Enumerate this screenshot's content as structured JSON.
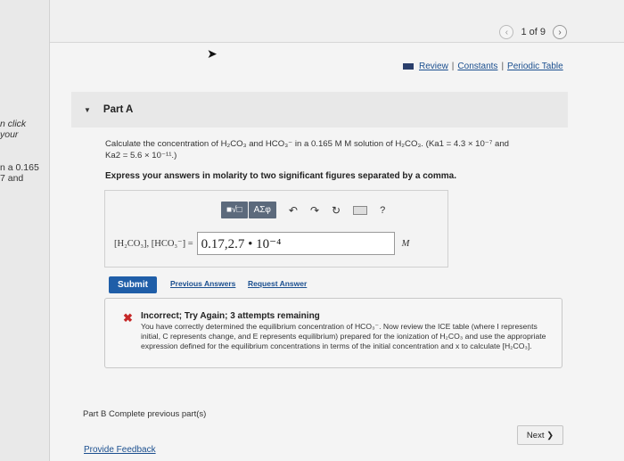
{
  "side_snippets": {
    "line1": "n click",
    "line2": "your",
    "line3": "n a 0.165",
    "line4": "7 and"
  },
  "pager": {
    "prev_icon": "chevron-left-icon",
    "label": "1 of 9",
    "next_icon": "chevron-right-icon"
  },
  "resources": {
    "review": "Review",
    "constants": "Constants",
    "periodic_table": "Periodic Table",
    "separator": "|"
  },
  "partA": {
    "title": "Part A",
    "question_pre": "Calculate the concentration of H",
    "question_line1": "Calculate the concentration of H₂CO₃ and HCO₃⁻ in a 0.165 M M solution of H₂CO₃. (Ka1 = 4.3 × 10⁻⁷ and",
    "question_line2": "Ka2 = 5.6 × 10⁻¹¹.)",
    "instruction": "Express your answers in molarity to two significant figures separated by a comma."
  },
  "toolbar": {
    "template_label": "■√□",
    "greek_label": "ΑΣφ",
    "undo_icon": "↶",
    "redo_icon": "↷",
    "reset_icon": "↻",
    "keyboard_icon": "keyboard-icon",
    "help_label": "?"
  },
  "answer": {
    "label": "[H₂CO₃], [HCO₃⁻] =",
    "value": "0.17,2.7 • 10⁻⁴",
    "unit": "M"
  },
  "actions": {
    "submit": "Submit",
    "previous_answers": "Previous Answers",
    "request_answer": "Request Answer"
  },
  "feedback": {
    "title": "Incorrect; Try Again; 3 attempts remaining",
    "body": "You have correctly determined the equilibrium concentration of HCO₃⁻. Now review the ICE table (where I represents initial, C represents change, and E represents equilibrium) prepared for the ionization of H₂CO₃ and use the appropriate expression defined for the equilibrium concentrations in terms of the initial concentration and x to calculate [H₂CO₃]."
  },
  "partB": {
    "label": "Part B",
    "text": "Complete previous part(s)"
  },
  "footer": {
    "next": "Next ❯",
    "provide_feedback": "Provide Feedback"
  }
}
